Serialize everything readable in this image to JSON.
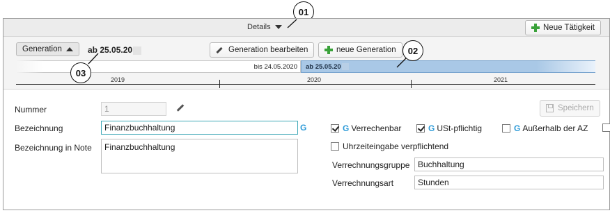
{
  "header": {
    "details_label": "Details",
    "new_activity_label": "Neue Tätigkeit"
  },
  "generation": {
    "toggle_label": "Generation",
    "current_date": "ab 25.05.20",
    "edit_label": "Generation bearbeiten",
    "new_label": "neue Generation",
    "timeline": {
      "previous_label": "bis 24.05.2020",
      "current_label": "ab 25.05.20",
      "years": [
        "2019",
        "2020",
        "2021"
      ]
    }
  },
  "callouts": [
    "01",
    "02",
    "03"
  ],
  "form": {
    "nummer_label": "Nummer",
    "nummer_value": "1",
    "bezeichnung_label": "Bezeichnung",
    "bezeichnung_value": "Finanzbuchhaltung",
    "note_label": "Bezeichnung in Note",
    "note_value": "Finanzbuchhaltung",
    "g_marker": "G",
    "save_label": "Speichern",
    "checkboxes": [
      {
        "label": "Verrechenbar",
        "checked": true,
        "g": true
      },
      {
        "label": "USt-pflichtig",
        "checked": true,
        "g": true
      },
      {
        "label": "Außerhalb der AZ",
        "checked": false,
        "g": true
      },
      {
        "label": "Uhrzeiteingabe verpflichtend",
        "checked": false,
        "g": false
      }
    ],
    "verrechnungsgruppe_label": "Verrechnungsgruppe",
    "verrechnungsgruppe_value": "Buchhaltung",
    "verrechnungsart_label": "Verrechnungsart",
    "verrechnungsart_value": "Stunden"
  }
}
